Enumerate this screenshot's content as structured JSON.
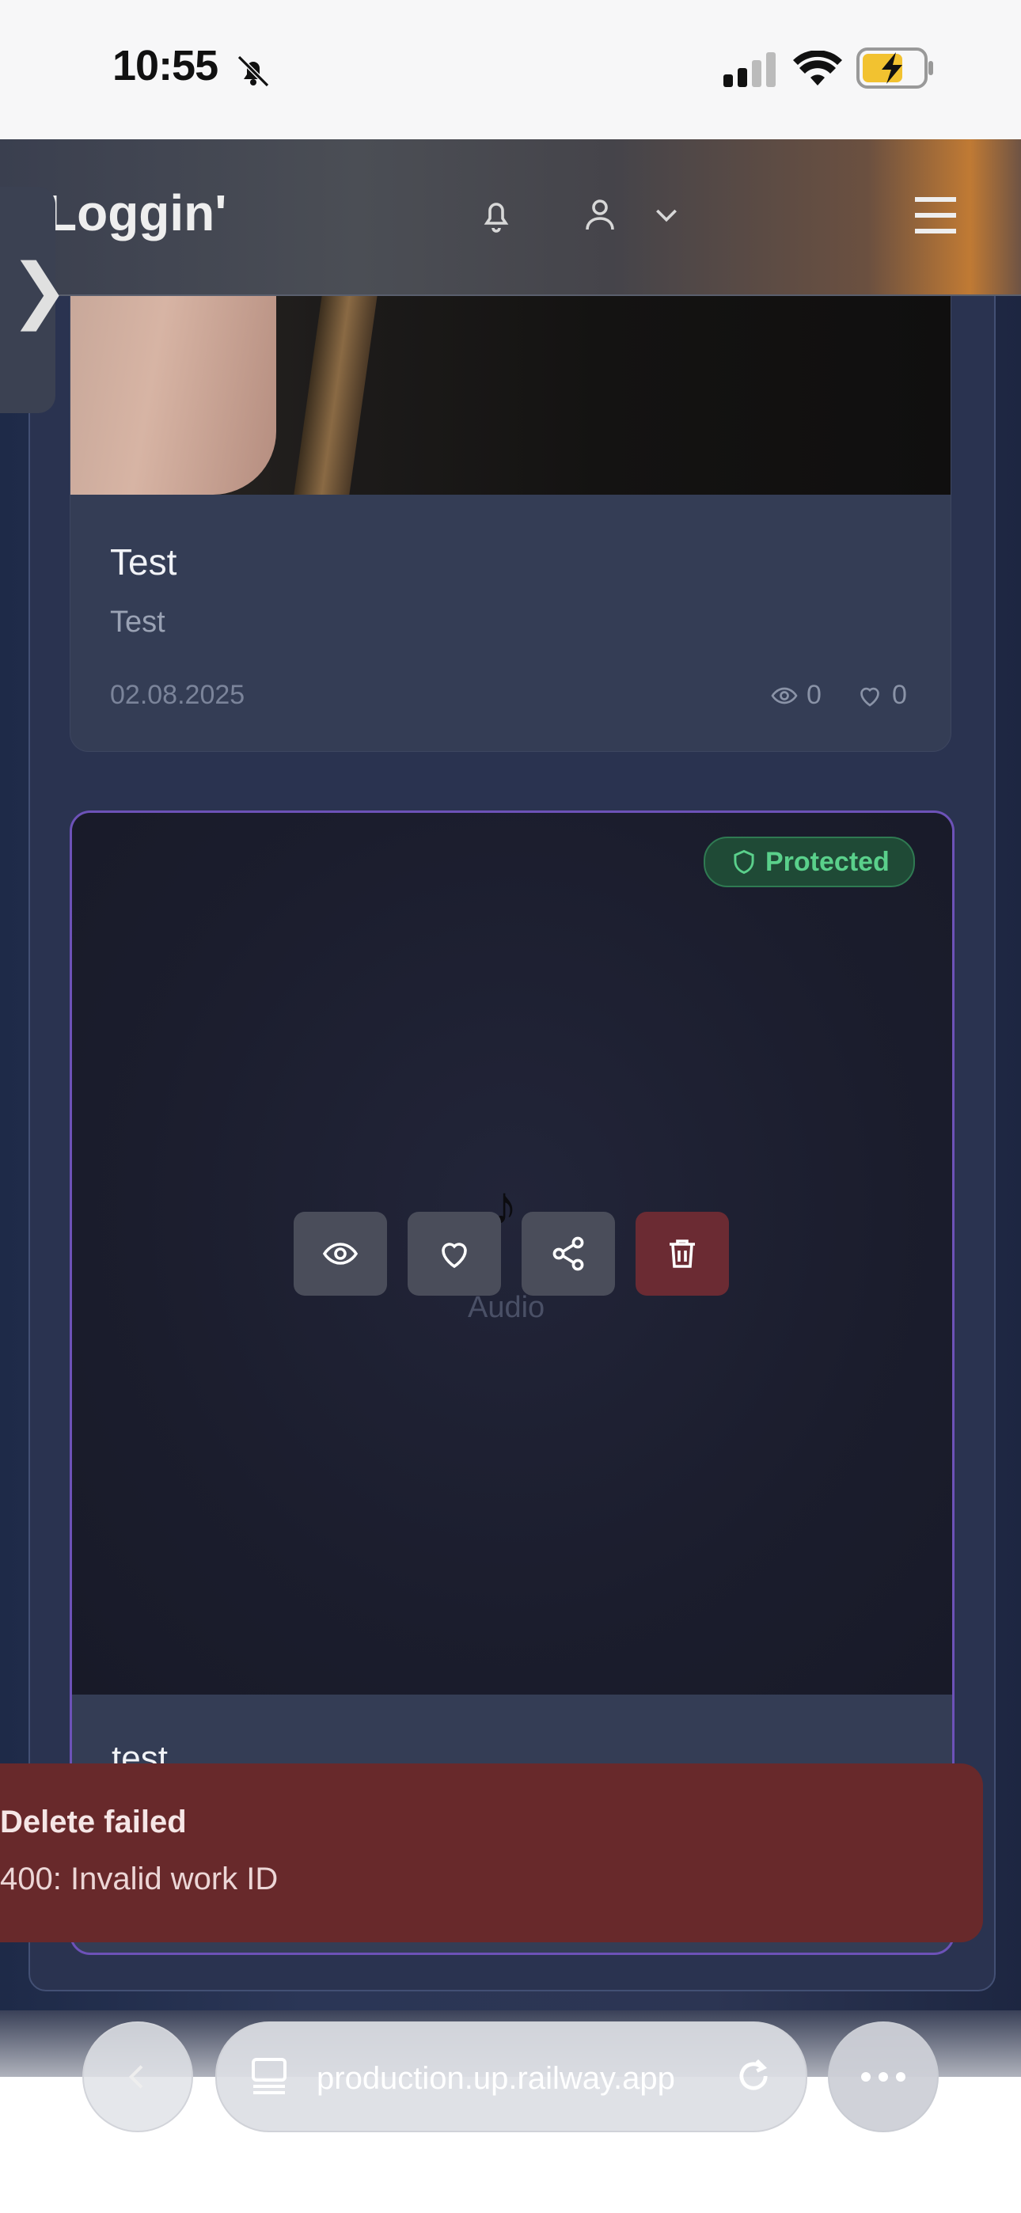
{
  "status_bar": {
    "time": "10:55",
    "icons": [
      "bell-slash-icon",
      "signal-icon",
      "wifi-icon",
      "battery-charging-icon"
    ]
  },
  "header": {
    "brand": "Loggin'",
    "side_tab_glyph": "❯"
  },
  "card1": {
    "title": "Test",
    "description": "Test",
    "date": "02.08.2025",
    "views": "0",
    "likes": "0"
  },
  "card2": {
    "badge": "Protected",
    "note_glyph": "♪",
    "media_label": "Audio",
    "title": "test",
    "actions": [
      "eye-icon",
      "heart-icon",
      "share-icon",
      "trash-icon"
    ]
  },
  "toast": {
    "title": "Delete failed",
    "message": "400: Invalid work ID"
  },
  "browser": {
    "url": "production.up.railway.app"
  },
  "colors": {
    "accent": "#6d52b8",
    "danger": "#68292b",
    "protected": "#5ad08b"
  }
}
